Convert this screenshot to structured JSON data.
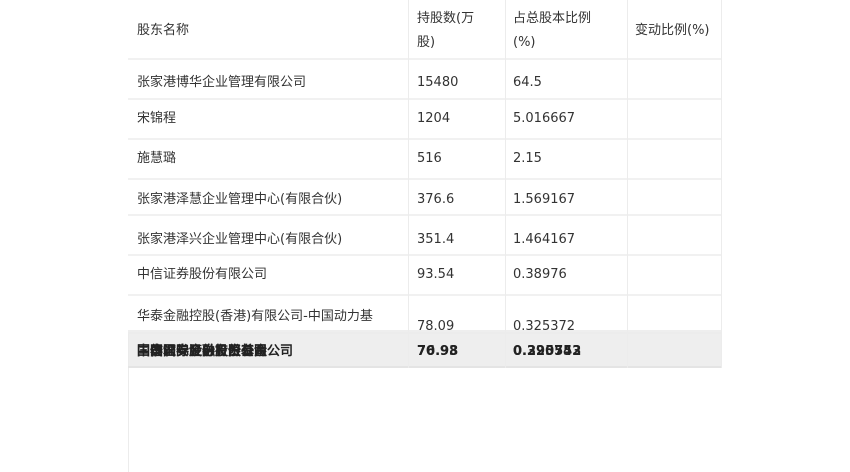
{
  "table": {
    "headers": {
      "name": "股东名称",
      "shares_line1": "持股数(万",
      "shares_line2": "股)",
      "ratio_line1": "占总股本比例",
      "ratio_line2": "(%)",
      "change": "变动比例(%)"
    },
    "rows": [
      {
        "name": "张家港博华企业管理有限公司",
        "shares": "15480",
        "ratio": "64.5",
        "change": ""
      },
      {
        "name": "宋锦程",
        "shares": "1204",
        "ratio": "5.016667",
        "change": ""
      },
      {
        "name": "施慧璐",
        "shares": "516",
        "ratio": "2.15",
        "change": ""
      },
      {
        "name": "张家港泽慧企业管理中心(有限合伙)",
        "shares": "376.6",
        "ratio": "1.569167",
        "change": ""
      },
      {
        "name": "张家港泽兴企业管理中心(有限合伙)",
        "shares": "351.4",
        "ratio": "1.464167",
        "change": ""
      },
      {
        "name": "中信证券股份有限公司",
        "shares": "93.54",
        "ratio": "0.38976",
        "change": ""
      },
      {
        "name": "华泰金融控股(香港)有限公司-中国动力基",
        "shares": "78.09",
        "ratio": "0.325372",
        "change": ""
      }
    ],
    "overlap_row": {
      "name_a": "国信证券股份有限公司",
      "name_b": "中国国际金融股份有限公司",
      "name_c": "国泰君安证券投资基金",
      "shares_a": "76.98",
      "shares_b": "70.93",
      "ratio_a": "0.320753",
      "ratio_b": "0.295542"
    }
  }
}
